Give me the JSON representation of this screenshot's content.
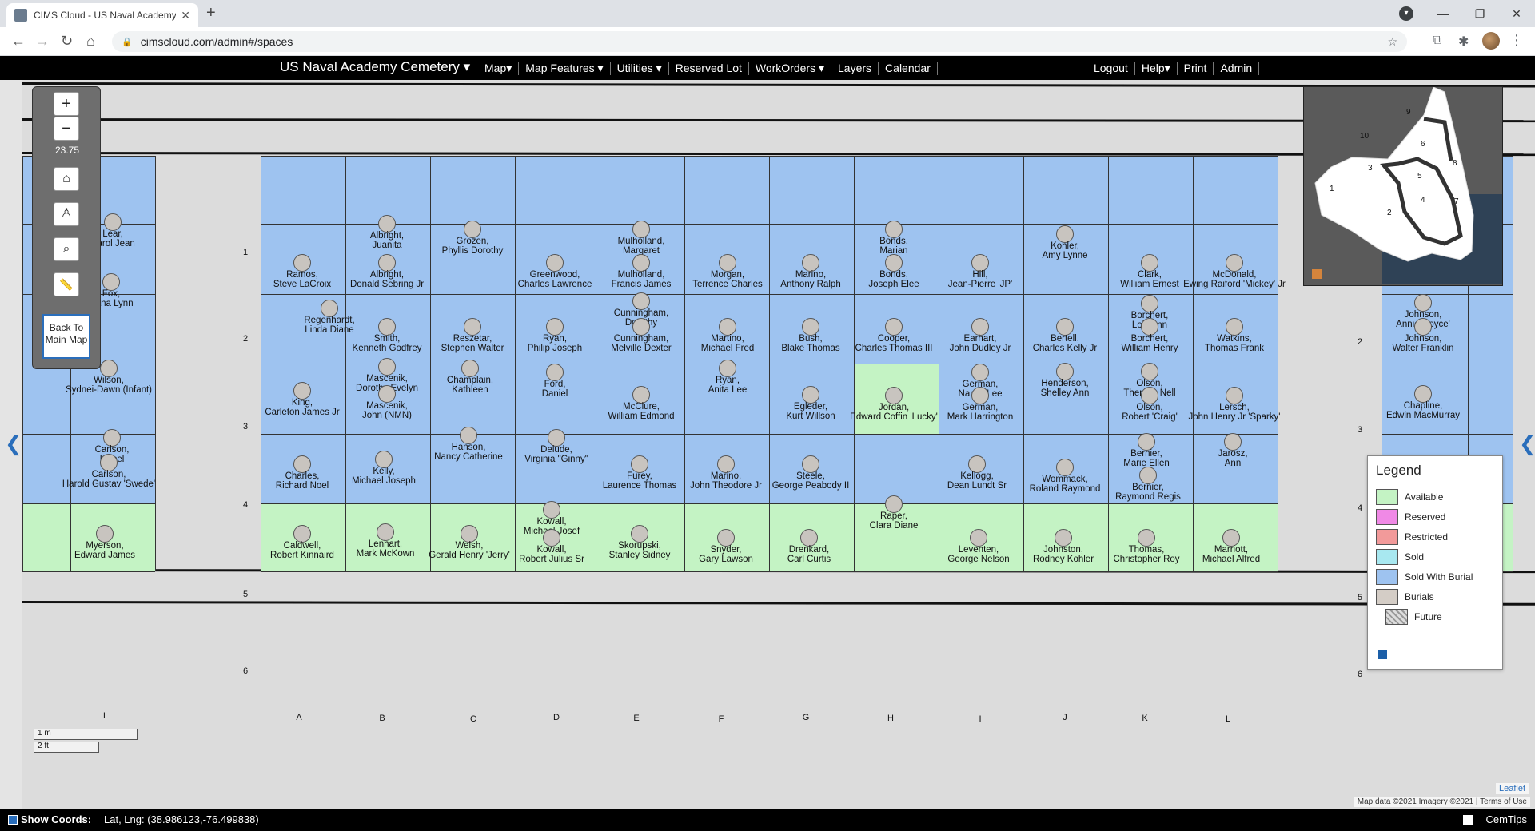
{
  "browser": {
    "tab_title": "CIMS Cloud - US Naval Academy",
    "url": "cimscloud.com/admin#/spaces"
  },
  "nav": {
    "brand": "US Naval Academy Cemetery ▾",
    "left_menu": [
      "Map▾",
      "Map Features ▾",
      "Utilities ▾",
      "Reserved Lot",
      "WorkOrders ▾",
      "Layers",
      "Calendar"
    ],
    "right_menu": [
      "Logout",
      "Help▾",
      "Print",
      "Admin"
    ]
  },
  "controls": {
    "zoom_in": "+",
    "zoom_out": "−",
    "zoom_level": "23.75",
    "back_to_main_map": "Back To Main Map"
  },
  "grid": {
    "columns": [
      "A",
      "B",
      "C",
      "D",
      "E",
      "F",
      "G",
      "H",
      "I",
      "J",
      "K",
      "L"
    ],
    "left_col_label": "L",
    "rows": [
      "1",
      "2",
      "3",
      "4",
      "5",
      "6"
    ],
    "right_rows": [
      "1",
      "2",
      "3",
      "4",
      "5",
      "6"
    ]
  },
  "burials": [
    {
      "name": "Lear, Carol Jean"
    },
    {
      "name": "Fox, Dana Lynn"
    },
    {
      "name": "Wilson, Sydnei-Dawn (Infant)"
    },
    {
      "name": "Carlson, Isabel"
    },
    {
      "name": "Carlson, Harold Gustav 'Swede'"
    },
    {
      "name": "Myerson, Edward James"
    },
    {
      "name": "Ramos, Steve LaCroix"
    },
    {
      "name": "Regenhardt, Linda Diane"
    },
    {
      "name": "King, Carleton James Jr"
    },
    {
      "name": "Charles, Richard Noel"
    },
    {
      "name": "Caldwell, Robert Kinnaird"
    },
    {
      "name": "Albright, Juanita"
    },
    {
      "name": "Albright, Donald Sebring Jr"
    },
    {
      "name": "Smith, Kenneth Godfrey"
    },
    {
      "name": "Mascenik, Dorothy Evelyn"
    },
    {
      "name": "Mascenik, John (NMN)"
    },
    {
      "name": "Kelly, Michael Joseph"
    },
    {
      "name": "Lenhart, Mark McKown"
    },
    {
      "name": "Grozen, Phyllis Dorothy"
    },
    {
      "name": "Reszetar, Stephen Walter"
    },
    {
      "name": "Champlain, Kathleen"
    },
    {
      "name": "Hanson, Nancy Catherine"
    },
    {
      "name": "Welsh, Gerald Henry 'Jerry'"
    },
    {
      "name": "Greenwood, Charles Lawrence"
    },
    {
      "name": "Ryan, Philip Joseph"
    },
    {
      "name": "Ford, Daniel"
    },
    {
      "name": "Delude, Virginia \"Ginny\""
    },
    {
      "name": "Kowall, Michael Josef"
    },
    {
      "name": "Kowall, Robert Julius Sr"
    },
    {
      "name": "Mulholland, Margaret"
    },
    {
      "name": "Mulholland, Francis James"
    },
    {
      "name": "Cunningham, Dorothy"
    },
    {
      "name": "Cunningham, Melville Dexter"
    },
    {
      "name": "McClure, William Edmond"
    },
    {
      "name": "Furey, Laurence Thomas"
    },
    {
      "name": "Skorupski, Stanley Sidney"
    },
    {
      "name": "Morgan, Terrence Charles"
    },
    {
      "name": "Martino, Michael Fred"
    },
    {
      "name": "Ryan, Anita Lee"
    },
    {
      "name": "Marino, John Theodore Jr"
    },
    {
      "name": "Snyder, Gary Lawson"
    },
    {
      "name": "Marino, Anthony Ralph"
    },
    {
      "name": "Bush, Blake Thomas"
    },
    {
      "name": "Egleder, Kurt Willson"
    },
    {
      "name": "Steele, George Peabody II"
    },
    {
      "name": "Drenkard, Carl Curtis"
    },
    {
      "name": "Bonds, Marian"
    },
    {
      "name": "Bonds, Joseph Elee"
    },
    {
      "name": "Cooper, Charles Thomas III"
    },
    {
      "name": "Jordan, Edward Coffin 'Lucky'"
    },
    {
      "name": "Raper, Clara Diane"
    },
    {
      "name": "Hill, Jean-Pierre 'JP'"
    },
    {
      "name": "Earhart, John Dudley Jr"
    },
    {
      "name": "German, Nancy Lee"
    },
    {
      "name": "German, Mark Harrington"
    },
    {
      "name": "Kellogg, Dean Lundt Sr"
    },
    {
      "name": "Leventen, George Nelson"
    },
    {
      "name": "Kohler, Amy Lynne"
    },
    {
      "name": "Bertell, Charles Kelly Jr"
    },
    {
      "name": "Henderson, Shelley Ann"
    },
    {
      "name": "Wommack, Roland Raymond"
    },
    {
      "name": "Johnston, Rodney Kohler"
    },
    {
      "name": "Clark, William Ernest"
    },
    {
      "name": "Borchert, Lois Ann"
    },
    {
      "name": "Borchert, William Henry"
    },
    {
      "name": "Olson, Theresa Nell"
    },
    {
      "name": "Olson, Robert 'Craig'"
    },
    {
      "name": "Bernier, Marie Ellen"
    },
    {
      "name": "Bernier, Raymond Regis"
    },
    {
      "name": "Thomas, Christopher Roy"
    },
    {
      "name": "McDonald, Ewing Raiford 'Mickey' Jr"
    },
    {
      "name": "Watkins, Thomas Frank"
    },
    {
      "name": "Lersch, John Henry Jr 'Sparky'"
    },
    {
      "name": "Jarosz, Ann"
    },
    {
      "name": "Marriott, Michael Alfred"
    },
    {
      "name": "Johnson, Annie 'Loyce'"
    },
    {
      "name": "Johnson, Walter Franklin"
    },
    {
      "name": "Chapline, Edwin MacMurray"
    }
  ],
  "legend": {
    "title": "Legend",
    "items": [
      {
        "label": "Available",
        "color": "#c4f3c4"
      },
      {
        "label": "Reserved",
        "color": "#f089e6"
      },
      {
        "label": "Restricted",
        "color": "#f29a9a"
      },
      {
        "label": "Sold",
        "color": "#a8e8f0"
      },
      {
        "label": "Sold With Burial",
        "color": "#9ec3f0"
      },
      {
        "label": "Burials",
        "color": "#d4cdc6"
      },
      {
        "label": "Future",
        "color": "hatch"
      }
    ]
  },
  "scale": {
    "metric": "1 m",
    "imperial": "2 ft"
  },
  "minimap": {
    "sections": [
      "9",
      "10",
      "6",
      "3",
      "8",
      "5",
      "1",
      "4",
      "7",
      "2"
    ]
  },
  "attribution": {
    "leaflet": "Leaflet",
    "text": "Map data ©2021 Imagery ©2021 | Terms of Use"
  },
  "status": {
    "show_coords": "Show Coords:",
    "coords": "Lat, Lng: (38.986123,-76.499838)",
    "cemtips": "CemTips"
  }
}
